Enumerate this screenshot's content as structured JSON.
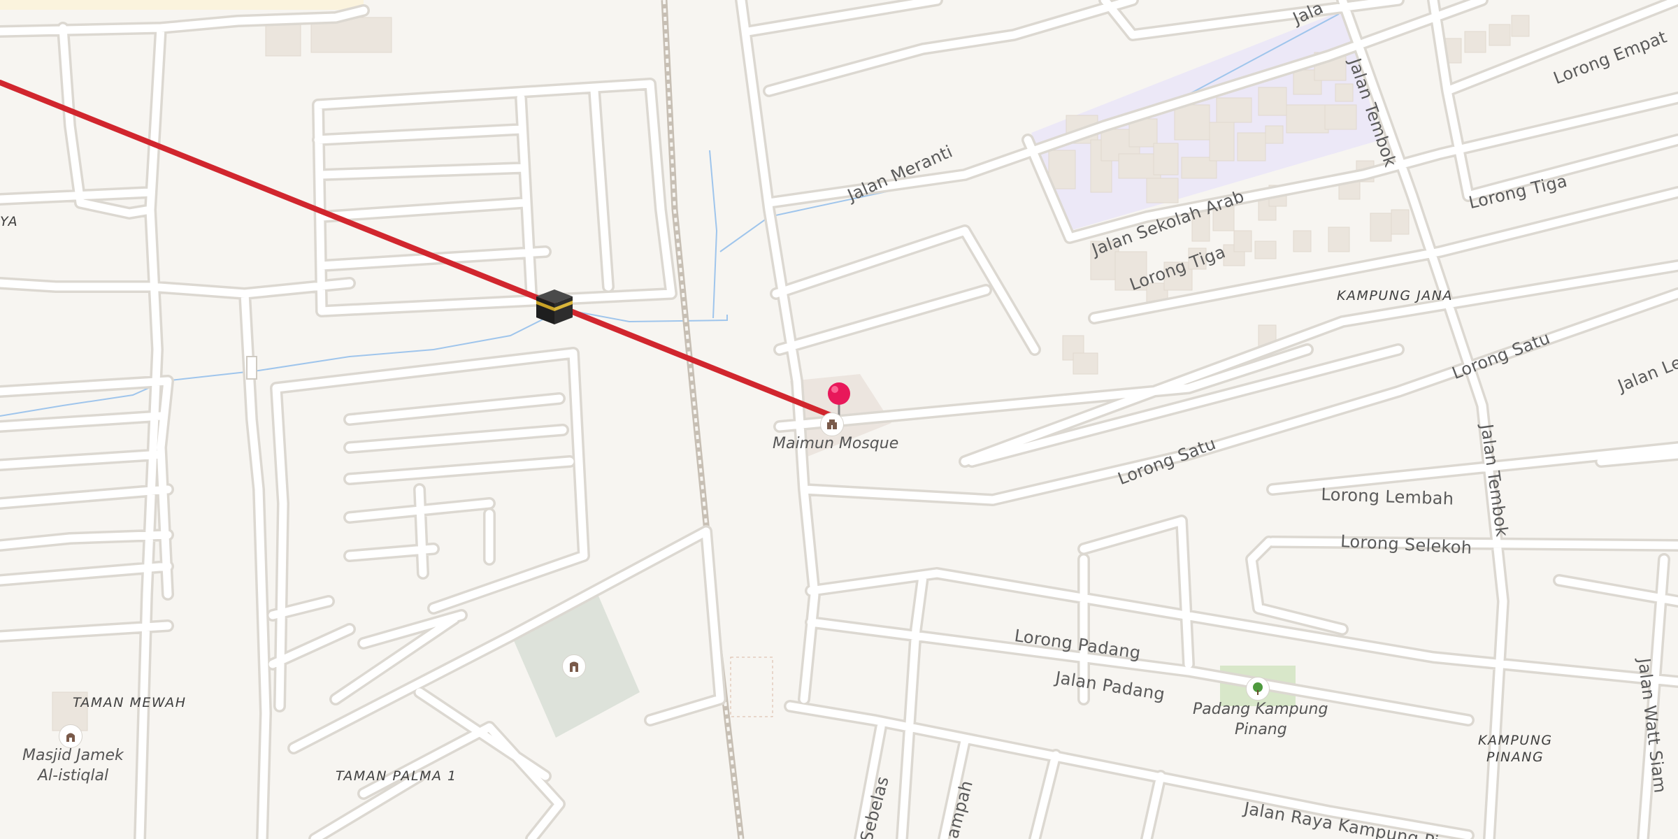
{
  "map": {
    "area_labels": {
      "kampung_jana": "KAMPUNG JANA",
      "taman_mewah": "TAMAN MEWAH",
      "taman_palma": "TAMAN PALMA 1",
      "kampung_pinang_1": "KAMPUNG",
      "kampung_pinang_2": "PINANG",
      "cut_left": "YA"
    },
    "street_labels": {
      "jalan_meranti": "Jalan Meranti",
      "jalan_sekolah_arab": "Jalan Sekolah Arab",
      "lorong_tiga_1": "Lorong Tiga",
      "lorong_tiga_2": "Lorong Tiga",
      "lorong_empat": "Lorong Empat",
      "jalan_tembok_1": "Jalan Tembok",
      "jalan_tembok_2": "Jalan Tembok",
      "lorong_satu_1": "Lorong Satu",
      "lorong_satu_2": "Lorong Satu",
      "lorong_lembah": "Lorong Lembah",
      "lorong_selekoh": "Lorong Selekoh",
      "lorong_padang": "Lorong Padang",
      "jalan_padang": "Jalan Padang",
      "jalan_raya": "Jalan Raya Kampung Pi",
      "jalan_watt_siam": "Jalan Watt Siam",
      "jalan_lem": "Jalan Lem",
      "jalan_top": "Jala",
      "sebelas": "Sebelas",
      "ampah": "ampah"
    },
    "pois": {
      "maimun_mosque": "Maimun Mosque",
      "masjid_jamek_1": "Masjid Jamek",
      "masjid_jamek_2": "Al-istiqlal",
      "padang_1": "Padang Kampung",
      "padang_2": "Pinang"
    },
    "icons": {
      "kaaba": "kaaba-icon",
      "destination_pin": "location-pin-icon",
      "mosque": "mosque-icon",
      "park": "tree-icon",
      "monument": "monument-icon"
    },
    "colors": {
      "background": "#f7f5f1",
      "qibla_line": "#d1262e",
      "pin": "#e8185a",
      "water": "#9fc5ec",
      "school_area": "#ece8f7",
      "park_area": "#d8e7c9",
      "grass_area": "#dde2da"
    }
  }
}
